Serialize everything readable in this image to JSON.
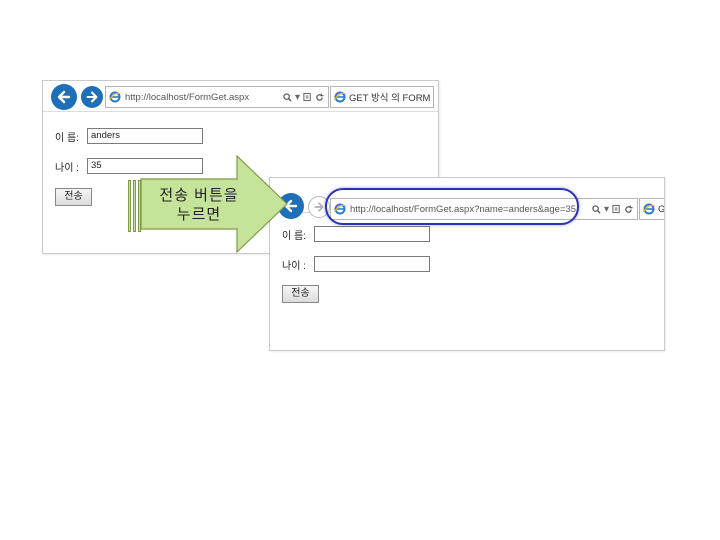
{
  "window1": {
    "url": "http://localhost/FormGet.aspx",
    "tab_title": "GET 방식 의 FORM",
    "name_label": "이 름:",
    "name_value": "anders",
    "age_label": "나이 :",
    "age_value": "35",
    "submit_label": "전송"
  },
  "callout": {
    "line1": "전송 버튼을",
    "line2": "누르면",
    "color": "#c6e39a",
    "border_color": "#7d9b46"
  },
  "window2": {
    "url": "http://localhost/FormGet.aspx?name=anders&age=35",
    "tab_title": "G",
    "name_label": "이 름:",
    "name_value": "",
    "age_label": "나이 :",
    "age_value": "",
    "submit_label": "전송",
    "highlight_color": "#2a33b5"
  },
  "icons": {
    "back": "back-arrow-icon",
    "forward": "forward-arrow-icon",
    "ie": "ie-logo-icon",
    "search": "search-icon",
    "compat": "compatibility-view-icon",
    "refresh": "refresh-icon"
  }
}
